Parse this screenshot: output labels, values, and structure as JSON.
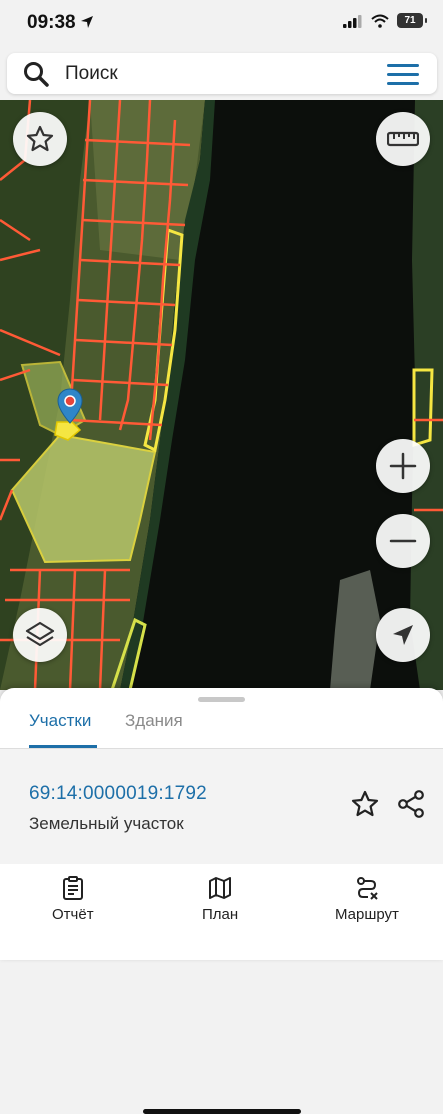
{
  "status": {
    "time": "09:38",
    "battery": "71"
  },
  "search": {
    "placeholder": "Поиск"
  },
  "tabs": [
    {
      "label": "Участки",
      "active": true
    },
    {
      "label": "Здания",
      "active": false
    }
  ],
  "parcel": {
    "cadastral_number": "69:14:0000019:1792",
    "type": "Земельный участок"
  },
  "nav": [
    {
      "label": "Отчёт",
      "icon": "report-icon"
    },
    {
      "label": "План",
      "icon": "map-icon"
    },
    {
      "label": "Маршрут",
      "icon": "route-icon"
    }
  ],
  "colors": {
    "accent": "#1d6fa8",
    "parcel_outline": "#ff5a36",
    "selected_parcel": "#f5e642"
  }
}
